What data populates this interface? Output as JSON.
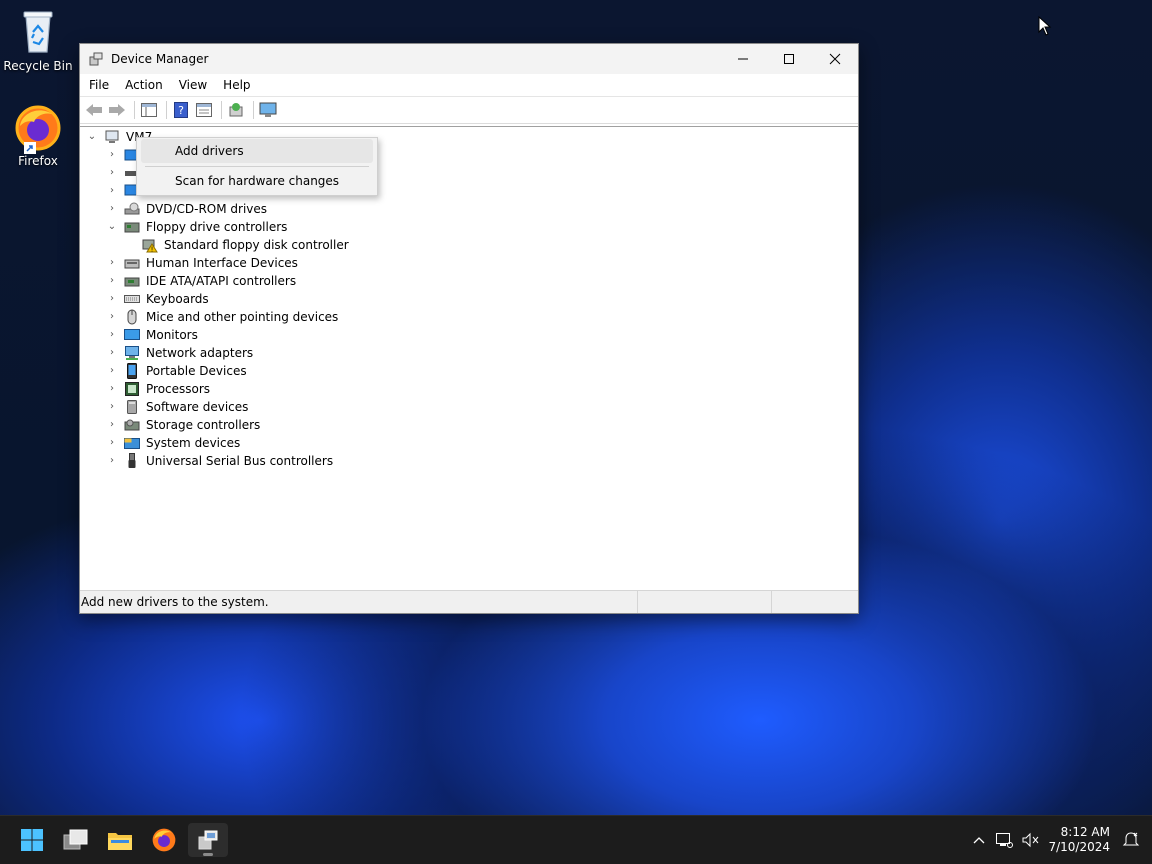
{
  "desktop": {
    "icons": [
      {
        "label": "Recycle Bin"
      },
      {
        "label": "Firefox"
      }
    ]
  },
  "window": {
    "title": "Device Manager",
    "menu": {
      "file": "File",
      "action": "Action",
      "view": "View",
      "help": "Help"
    },
    "tree": {
      "root": "VM7",
      "categories": [
        "DVD/CD-ROM drives",
        "Floppy drive controllers",
        "Standard floppy disk controller",
        "Human Interface Devices",
        "IDE ATA/ATAPI controllers",
        "Keyboards",
        "Mice and other pointing devices",
        "Monitors",
        "Network adapters",
        "Portable Devices",
        "Processors",
        "Software devices",
        "Storage controllers",
        "System devices",
        "Universal Serial Bus controllers"
      ]
    },
    "status_text": "Add new drivers to the system."
  },
  "context_menu": {
    "items": [
      "Add drivers",
      "Scan for hardware changes"
    ]
  },
  "taskbar": {
    "time": "8:12 AM",
    "date": "7/10/2024"
  },
  "colors": {
    "accent": "#0078d4",
    "warning": "#f5c400",
    "taskbar_bg": "#1c1c1c"
  }
}
